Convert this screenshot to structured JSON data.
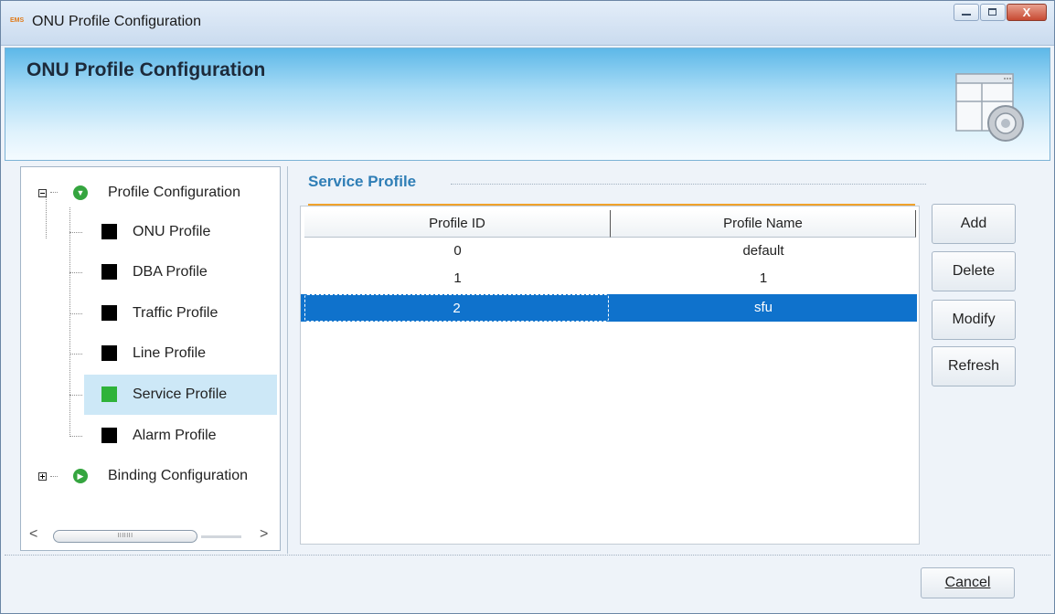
{
  "window": {
    "app_badge": "EMS",
    "title": "ONU Profile Configuration",
    "close_glyph": "X"
  },
  "header": {
    "title": "ONU Profile Configuration",
    "icon": "config-gear-window-icon"
  },
  "tree": {
    "groups": [
      {
        "label": "Profile Configuration",
        "expanded": true,
        "icon": "chevron-down-circle-icon",
        "items": [
          {
            "label": "ONU Profile",
            "selected": false
          },
          {
            "label": "DBA Profile",
            "selected": false
          },
          {
            "label": "Traffic Profile",
            "selected": false
          },
          {
            "label": "Line Profile",
            "selected": false
          },
          {
            "label": "Service Profile",
            "selected": true
          },
          {
            "label": "Alarm Profile",
            "selected": false
          }
        ]
      },
      {
        "label": "Binding Configuration",
        "expanded": false,
        "icon": "play-circle-icon"
      }
    ],
    "scroll_left": "<",
    "scroll_right": ">",
    "scroll_thumb": "IIIIIII"
  },
  "section": {
    "title": "Service Profile"
  },
  "table": {
    "columns": [
      "Profile ID",
      "Profile Name"
    ],
    "rows": [
      {
        "id": "0",
        "name": "default",
        "selected": false
      },
      {
        "id": "1",
        "name": "1",
        "selected": false
      },
      {
        "id": "2",
        "name": "sfu",
        "selected": true
      }
    ]
  },
  "actions": {
    "add": "Add",
    "delete": "Delete",
    "modify": "Modify",
    "refresh": "Refresh"
  },
  "footer": {
    "cancel": "Cancel"
  },
  "colors": {
    "accent": "#2f7eb6",
    "selection": "#0f72cc",
    "tab_rule": "#f0a22b",
    "tree_active": "#2fb33a"
  }
}
